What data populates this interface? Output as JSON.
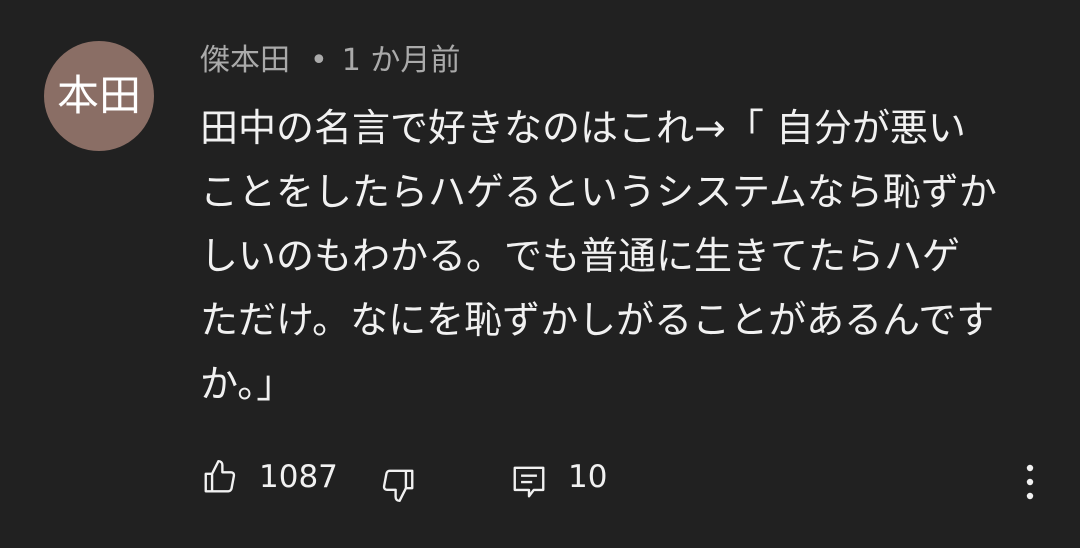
{
  "comment": {
    "avatar_text": "本田",
    "author": "傑本田",
    "separator": "•",
    "time": "1 か月前",
    "lines": [
      "田中の名言で好きなのはこれ→「 自分が悪い",
      "ことをしたらハゲるというシステムなら恥ずか",
      "しいのもわかる。でも普通に生きてたらハゲ",
      "ただけ。なにを恥ずかしがることがあるんです",
      "か。」"
    ],
    "like_count": "1087",
    "reply_count": "10"
  },
  "icons": {
    "like": "thumbs-up-icon",
    "dislike": "thumbs-down-icon",
    "reply": "comment-icon",
    "more": "more-vertical-icon"
  },
  "colors": {
    "background": "#212121",
    "text_primary": "#f1f1f1",
    "text_secondary": "#aaaaaa",
    "avatar_bg": "#8a6e65"
  }
}
